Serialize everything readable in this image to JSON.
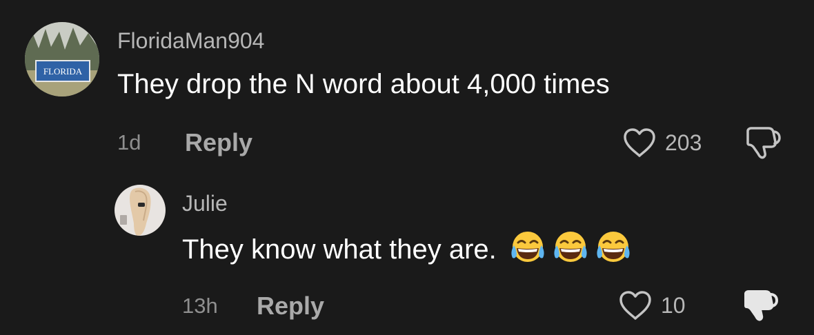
{
  "comments": [
    {
      "username": "FloridaMan904",
      "avatar_sign_text": "FLORIDA",
      "text": "They drop the N word about 4,000 times",
      "age": "1d",
      "reply_label": "Reply",
      "likes": "203",
      "disliked": false
    },
    {
      "username": "Julie",
      "text": "They know what they are.",
      "emojis": [
        "face-with-tears-of-joy",
        "face-with-tears-of-joy",
        "face-with-tears-of-joy"
      ],
      "age": "13h",
      "reply_label": "Reply",
      "likes": "10",
      "disliked": true
    }
  ],
  "colors": {
    "background": "#1a1a1a",
    "username": "#b6b6b6",
    "text": "#ffffff",
    "meta": "#8f8f8f",
    "reply": "#a9a9a9"
  }
}
